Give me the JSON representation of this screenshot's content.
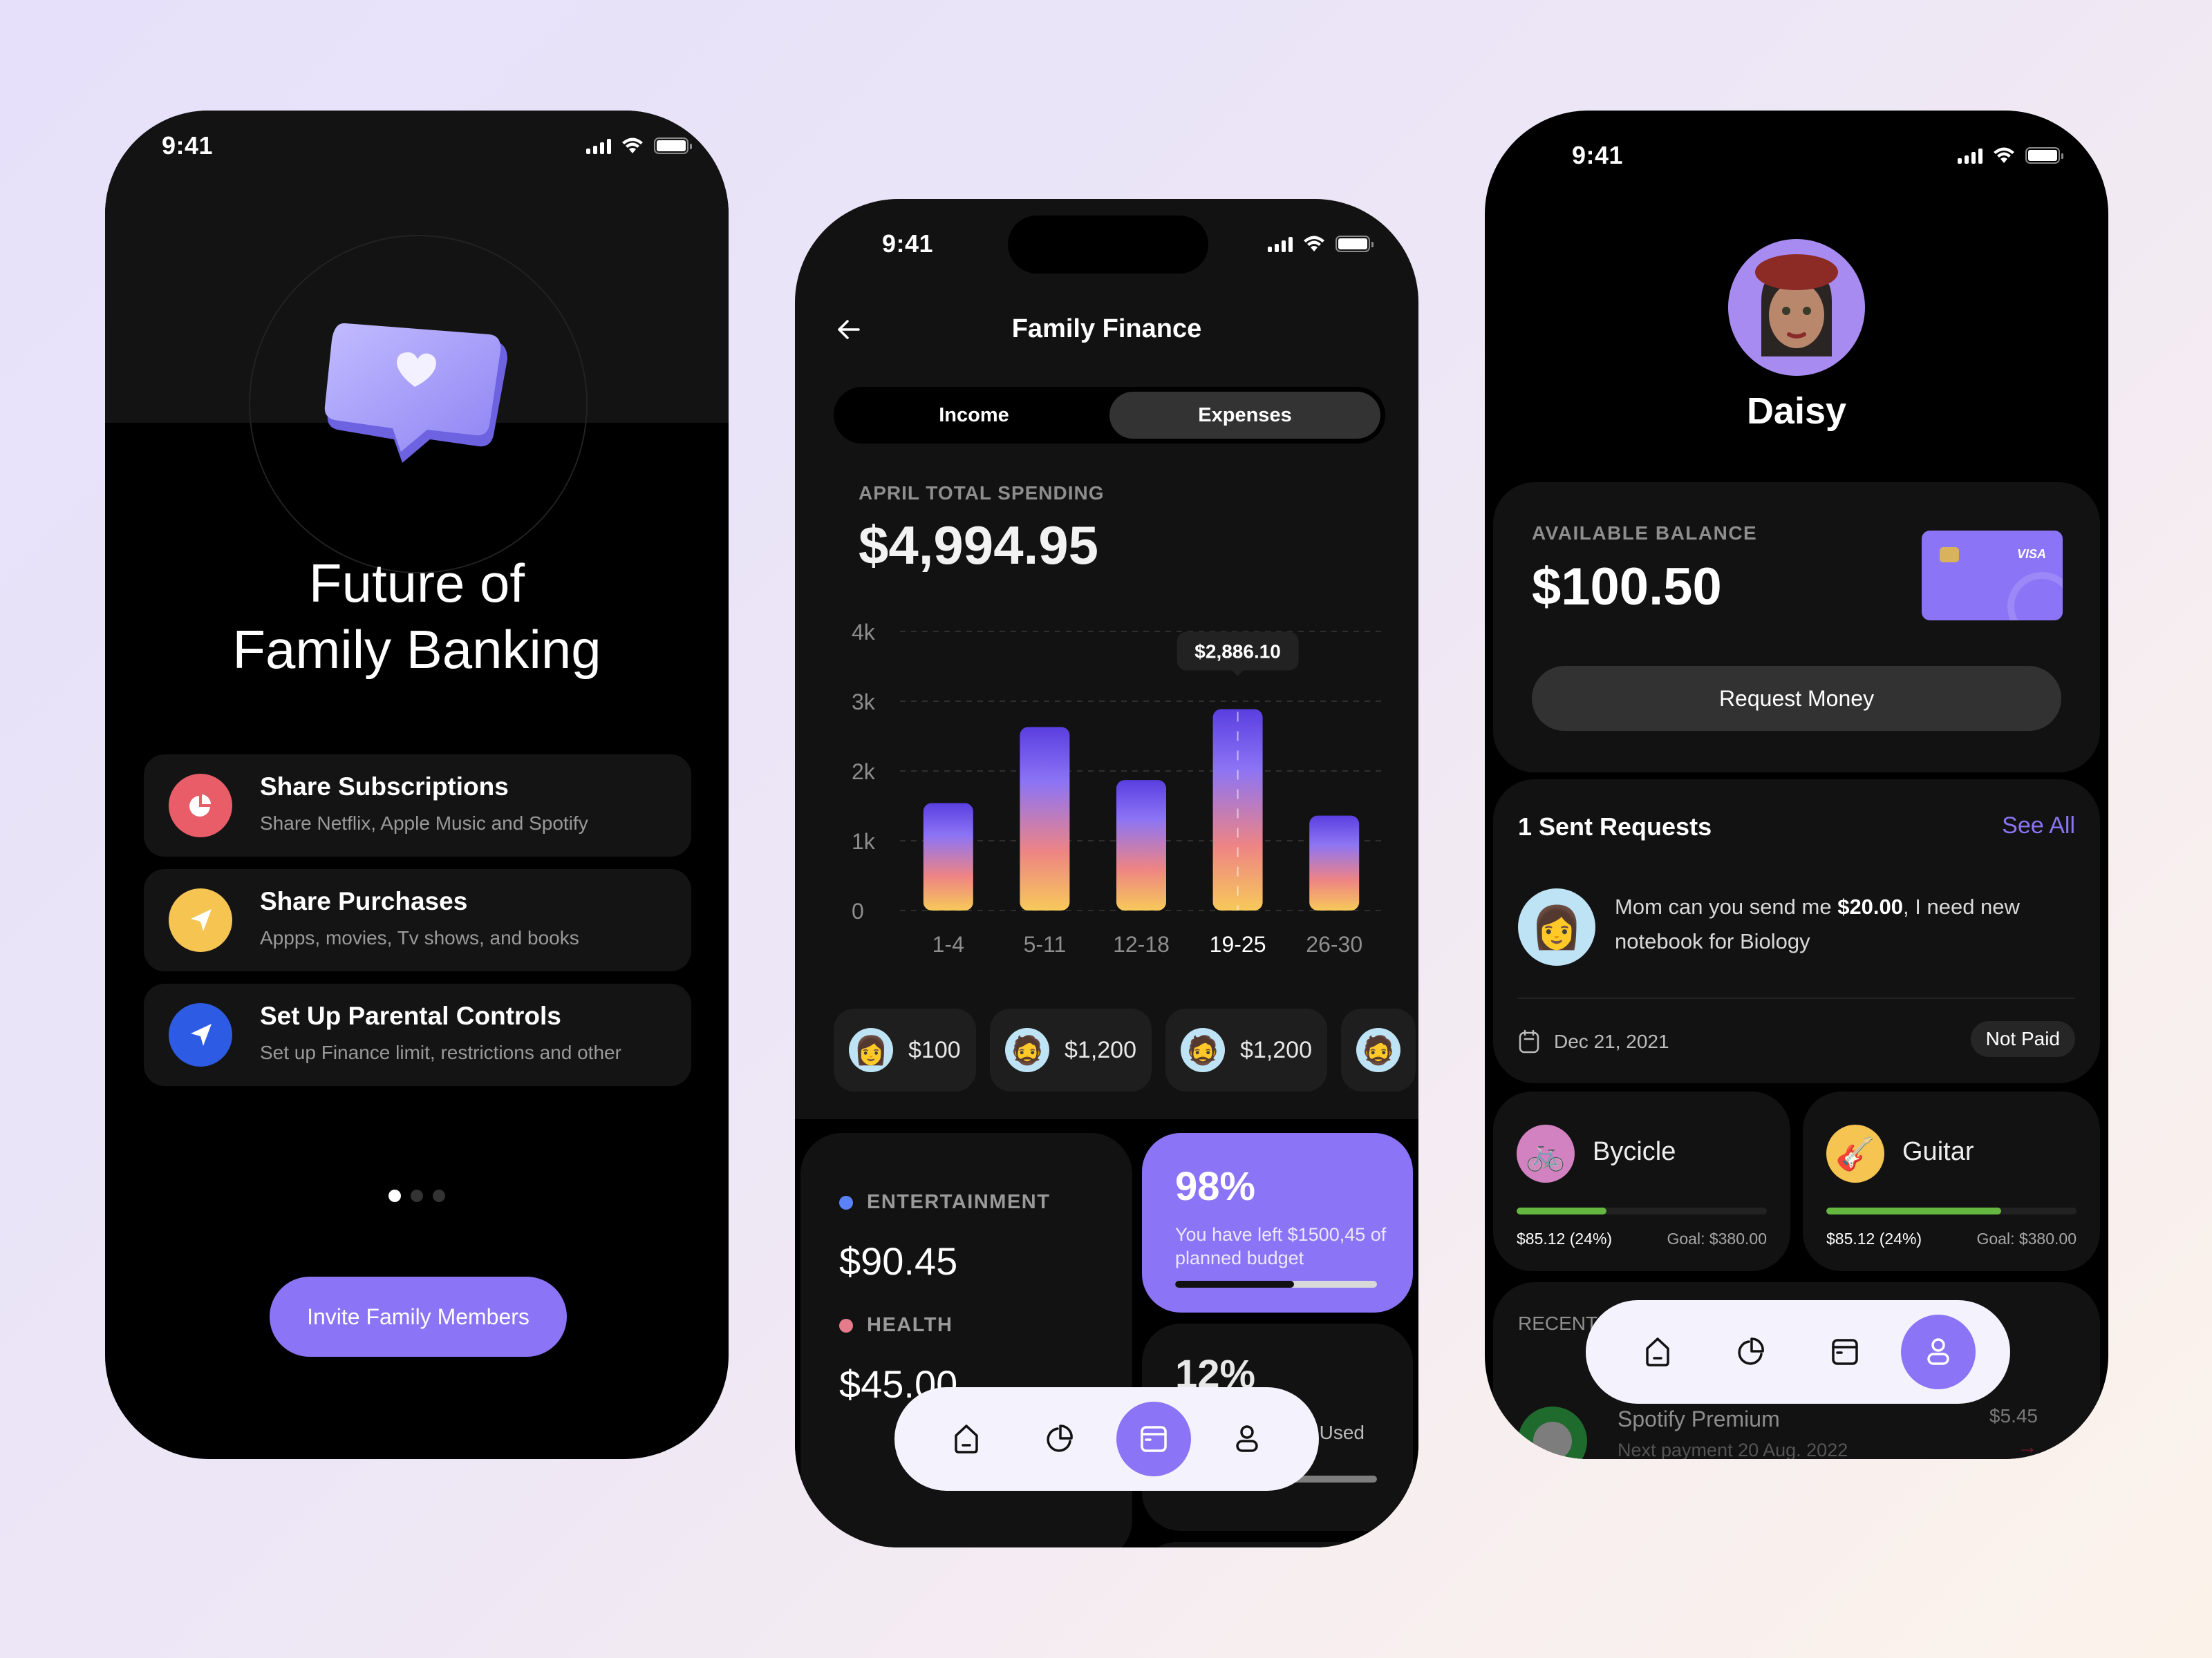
{
  "status_bar": {
    "time": "9:41"
  },
  "onboarding": {
    "title_line1": "Future of",
    "title_line2": "Family Banking",
    "features": [
      {
        "icon": "pie-chart-icon",
        "color": "#e85d67",
        "title": "Share Subscriptions",
        "subtitle": "Share Netflix, Apple Music and Spotify"
      },
      {
        "icon": "send-icon",
        "color": "#f5c451",
        "title": "Share Purchases",
        "subtitle": "Appps, movies, Tv shows, and books"
      },
      {
        "icon": "send-icon",
        "color": "#2d5be3",
        "title": "Set Up Parental Controls",
        "subtitle": "Set up Finance limit, restrictions and other"
      }
    ],
    "page_dots": {
      "count": 3,
      "active_index": 0
    },
    "invite_button": "Invite Family Members"
  },
  "finance": {
    "title": "Family Finance",
    "tabs": [
      {
        "label": "Income",
        "active": false
      },
      {
        "label": "Expenses",
        "active": true
      }
    ],
    "spending_label": "APRIL TOTAL SPENDING",
    "spending_value": "$4,994.95",
    "members": [
      {
        "avatar": "girl-cap-avatar",
        "amount": "$100"
      },
      {
        "avatar": "bearded-man-avatar",
        "amount": "$1,200"
      },
      {
        "avatar": "bearded-man-avatar",
        "amount": "$1,200"
      },
      {
        "avatar": "bearded-man-avatar",
        "amount": ""
      }
    ],
    "categories": [
      {
        "label": "ENTERTAINMENT",
        "color": "#5b82f6",
        "value": "$90.45"
      },
      {
        "label": "HEALTH",
        "color": "#e67b8c",
        "value": "$45.00"
      }
    ],
    "budget_card": {
      "percent": "98%",
      "text": "You have left $1500,45 of planned budget",
      "progress": 0.59
    },
    "used_card": {
      "percent": "12%",
      "text": "Used"
    }
  },
  "chart_data": {
    "type": "bar",
    "categories": [
      "1-4",
      "5-11",
      "12-18",
      "19-25",
      "26-30"
    ],
    "values": [
      1540,
      2630,
      1870,
      2886.1,
      1360
    ],
    "highlight_index": 3,
    "tooltip": "$2,886.10",
    "yticks": [
      "0",
      "1k",
      "2k",
      "3k",
      "4k"
    ],
    "ylim": [
      0,
      4000
    ],
    "grid": true,
    "gradient": [
      "#5a3fe0",
      "#8c74f5",
      "#ee8484",
      "#f7c95a"
    ],
    "title": "",
    "xlabel": "",
    "ylabel": ""
  },
  "profile": {
    "name": "Daisy",
    "balance_label": "AVAILABLE BALANCE",
    "balance_value": "$100.50",
    "card_brand": "VISA",
    "request_button": "Request Money",
    "sent_requests_title": "1 Sent Requests",
    "see_all": "See All",
    "request": {
      "message_prefix": "Mom can you send me ",
      "message_amount": "$20.00",
      "message_suffix": ", I need new notebook for Biology",
      "date": "Dec 21, 2021",
      "status": "Not Paid"
    },
    "goals": [
      {
        "name": "Bycicle",
        "emoji": "🚲",
        "color": "#d281c1",
        "saved": "$85.12 (24%)",
        "goal": "Goal: $380.00",
        "progress": 0.36
      },
      {
        "name": "Guitar",
        "emoji": "🎸",
        "color": "#f5c451",
        "saved": "$85.12 (24%)",
        "goal": "Goal: $380.00",
        "progress": 0.7
      }
    ],
    "recent_label": "RECENT",
    "recent_item": {
      "title": "Spotify Premium",
      "subtitle": "Next payment 20 Aug. 2022",
      "amount": "$5.45"
    }
  },
  "tab_bar": {
    "items": [
      "home",
      "stats",
      "card",
      "profile"
    ],
    "finance_active": "card",
    "profile_active": "profile"
  }
}
